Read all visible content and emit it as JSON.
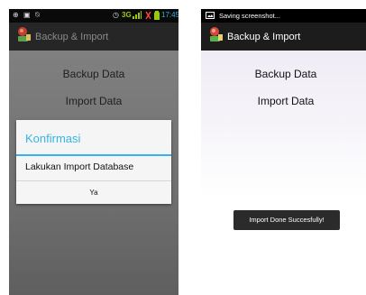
{
  "left_phone": {
    "status": {
      "network_label": "3G",
      "time": "17:45",
      "colors": {
        "network": "#99cc00",
        "time": "#33b5e5",
        "battery": "#99cc00"
      }
    },
    "app_title": "Backup & Import",
    "menu": [
      "Backup Data",
      "Import Data"
    ],
    "dialog": {
      "title": "Konfirmasi",
      "message": "Lakukan Import Database",
      "button": "Ya",
      "accent": "#33b5e5"
    }
  },
  "right_phone": {
    "status": {
      "notification_text": "Saving screenshot..."
    },
    "app_title": "Backup & Import",
    "menu": [
      "Backup Data",
      "Import Data"
    ],
    "toast": "Import Done Succesfully!"
  }
}
